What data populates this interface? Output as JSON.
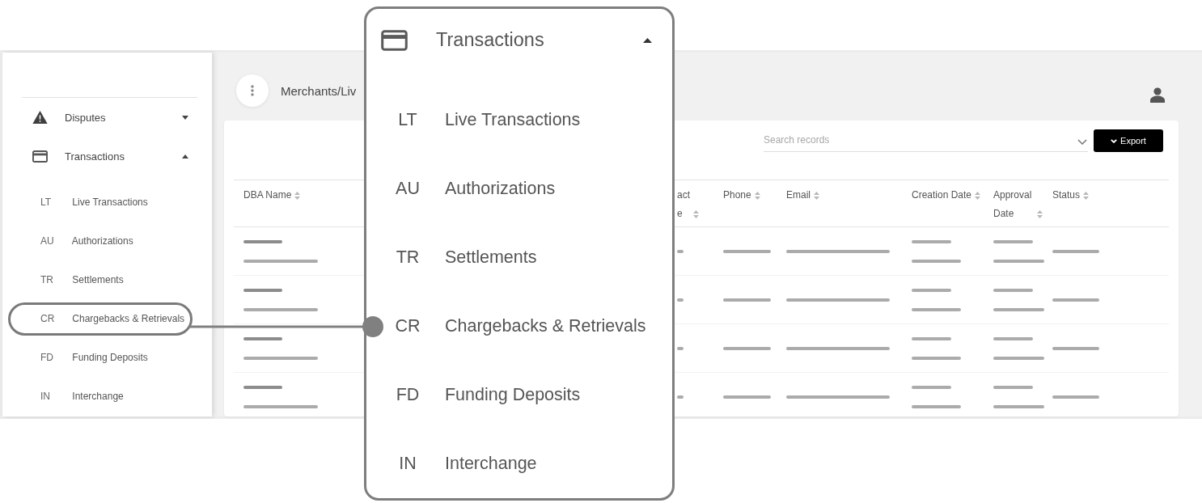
{
  "sidebar": {
    "items": [
      {
        "label": "Disputes",
        "expanded": false
      },
      {
        "label": "Transactions",
        "expanded": true,
        "children": [
          {
            "abbr": "LT",
            "label": "Live Transactions",
            "highlighted": false
          },
          {
            "abbr": "AU",
            "label": "Authorizations",
            "highlighted": false
          },
          {
            "abbr": "TR",
            "label": "Settlements",
            "highlighted": false
          },
          {
            "abbr": "CR",
            "label": "Chargebacks & Retrievals",
            "highlighted": true
          },
          {
            "abbr": "FD",
            "label": "Funding Deposits",
            "highlighted": false
          },
          {
            "abbr": "IN",
            "label": "Interchange",
            "highlighted": false
          }
        ]
      }
    ]
  },
  "header": {
    "breadcrumb": "Merchants/Liv"
  },
  "toolbar": {
    "search": {
      "placeholder": "Search records"
    },
    "export_button": "Export"
  },
  "table": {
    "columns": [
      {
        "label": "DBA Name",
        "sortable": true
      },
      {
        "label": "act e",
        "sortable": true
      },
      {
        "label": "Phone",
        "sortable": true
      },
      {
        "label": "Email",
        "sortable": true
      },
      {
        "label": "Creation Date",
        "sortable": true
      },
      {
        "label": "Approval Date",
        "sortable": true
      },
      {
        "label": "Status",
        "sortable": true
      }
    ],
    "rows": [
      {
        "loading": true
      },
      {
        "loading": true
      },
      {
        "loading": true
      },
      {
        "loading": true
      }
    ]
  },
  "zoom_callout": {
    "title": "Transactions",
    "expanded": true,
    "items": [
      {
        "abbr": "LT",
        "label": "Live Transactions"
      },
      {
        "abbr": "AU",
        "label": "Authorizations"
      },
      {
        "abbr": "TR",
        "label": "Settlements"
      },
      {
        "abbr": "CR",
        "label": "Chargebacks & Retrievals"
      },
      {
        "abbr": "FD",
        "label": "Funding Deposits"
      },
      {
        "abbr": "IN",
        "label": "Interchange"
      }
    ]
  }
}
